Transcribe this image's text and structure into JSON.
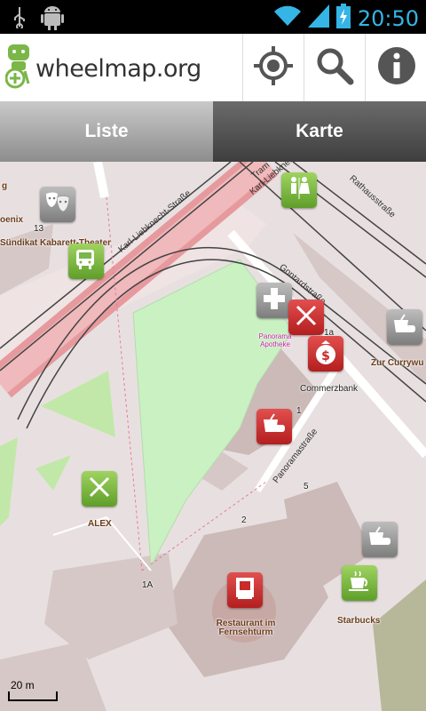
{
  "status_bar": {
    "time": "20:50",
    "icons": [
      "usb-icon",
      "android-debug-icon",
      "wifi-icon",
      "signal-icon",
      "battery-charging-icon"
    ]
  },
  "action_bar": {
    "logo_text": "wheelmap.org",
    "logo_icon": "wheelchair-person-icon",
    "actions": [
      "locate-icon",
      "search-icon",
      "info-icon"
    ]
  },
  "tabs": [
    {
      "label": "Liste",
      "selected": false
    },
    {
      "label": "Karte",
      "selected": true
    }
  ],
  "map": {
    "streets": [
      "Karl-Liebknecht-Straße",
      "Karl-Liebknecht-",
      "Gontardstraße",
      "Panoramastraße",
      "Rathausstraße",
      "Tram"
    ],
    "house_numbers": [
      "13",
      "1a",
      "1",
      "5",
      "2",
      "1A"
    ],
    "places": {
      "kabarett": "Sündikat Kabarett-Theater",
      "phoenix_fragment": "oenix",
      "top_left_fragment": "g",
      "apotheke": "Panorama Apotheke",
      "commerzbank": "Commerzbank",
      "zur_currywurst": "Zur Currywu",
      "alex": "ALEX",
      "restaurant": "Restaurant im Fernsehturm",
      "starbucks": "Starbucks"
    },
    "scale_label": "20 m",
    "marker_colors": {
      "gray": "#8a8a8a",
      "red": "#c92a2a",
      "green": "#7ab648"
    }
  }
}
